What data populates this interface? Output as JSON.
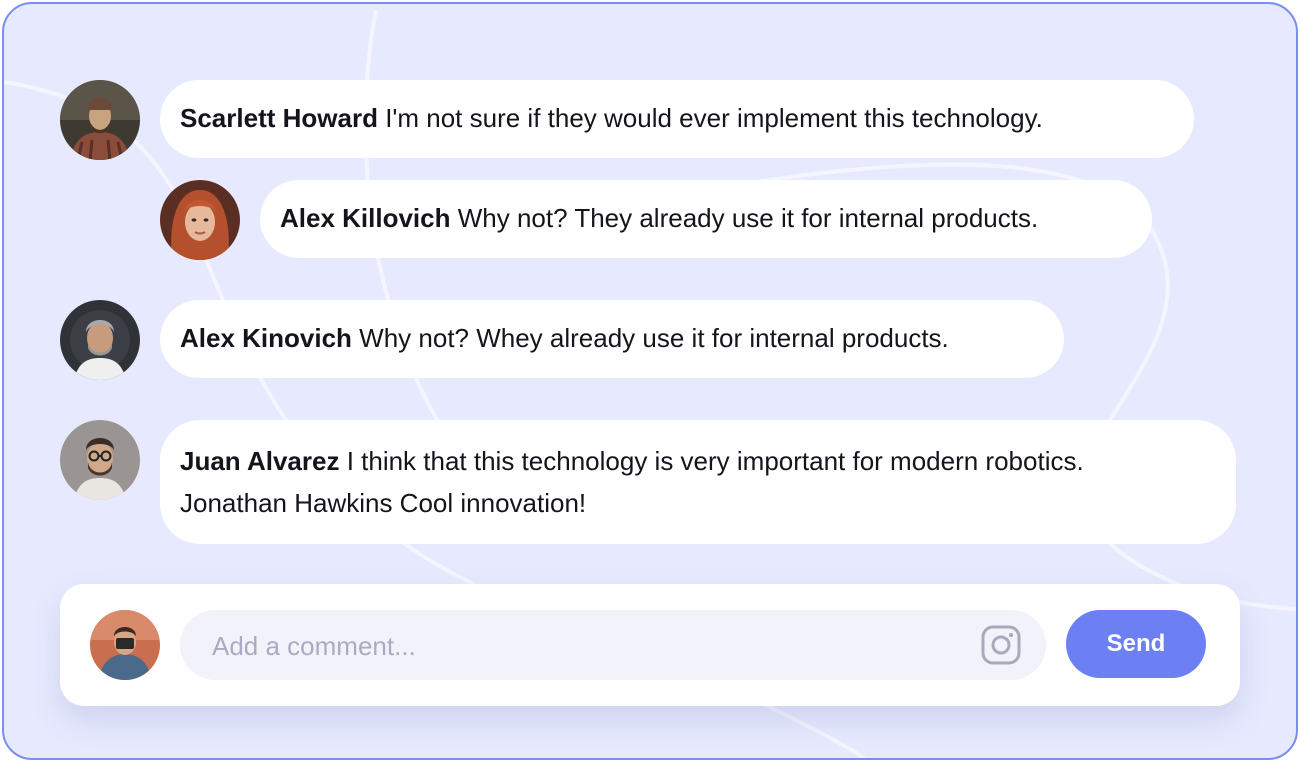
{
  "theme": {
    "frame_border": "#7b8ef0",
    "background": "#e7eafe",
    "accent": "#6c80f3",
    "bubble": "#ffffff"
  },
  "comments": [
    {
      "author": "Scarlett Howard",
      "text": "I'm not sure if they would ever implement this technology.",
      "avatar": "avatar-man-beanie-plaid-shirt"
    },
    {
      "author": "Alex Killovich",
      "text": "Why not? They already use it for internal products.",
      "avatar": "avatar-woman-red-hair",
      "reply": true
    },
    {
      "author": "Alex Kinovich",
      "text": "Why not? Whey already use it for internal products.",
      "avatar": "avatar-man-gray-hair-beard"
    },
    {
      "author": "Juan Alvarez",
      "text": "I think that this technology is very important for modern robotics.",
      "text_line2": "Jonathan Hawkins Cool innovation!",
      "avatar": "avatar-man-glasses-beard"
    }
  ],
  "composer": {
    "avatar": "avatar-current-user",
    "placeholder": "Add a comment...",
    "value": "",
    "attach_icon": "instagram-icon",
    "send_label": "Send"
  }
}
